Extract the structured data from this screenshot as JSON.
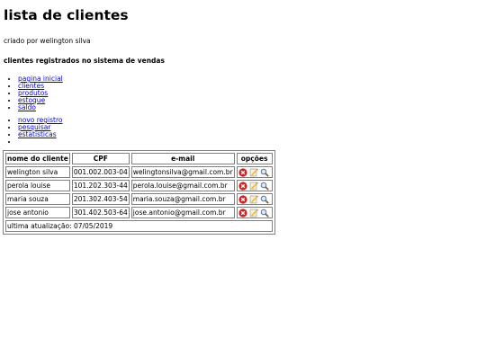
{
  "page": {
    "title": "lista de clientes",
    "subtitle": "criado por welington silva",
    "section_heading": "clientes registrados no sistema de vendas"
  },
  "nav": {
    "items": [
      {
        "label": "pagina inicial"
      },
      {
        "label": "clientes"
      },
      {
        "label": "produtos"
      },
      {
        "label": "estoque"
      },
      {
        "label": "saldo"
      }
    ]
  },
  "actions": {
    "items": [
      {
        "label": "novo registro"
      },
      {
        "label": "pesquisar"
      },
      {
        "label": "estatisticas"
      },
      {
        "label": ""
      }
    ]
  },
  "table": {
    "headers": [
      "nome do cliente",
      "CPF",
      "e-mail",
      "opções"
    ],
    "rows": [
      {
        "nome": "welington silva",
        "cpf": "001.002.003-04",
        "email": "welingtonsilva@gmail.com.br"
      },
      {
        "nome": "perola louise",
        "cpf": "101.202.303-44",
        "email": "perola.louise@gmail.com.br"
      },
      {
        "nome": "maria souza",
        "cpf": "201.302.403-54",
        "email": "maria.souza@gmail.com.br"
      },
      {
        "nome": "jose antonio",
        "cpf": "301.402.503-64",
        "email": "jose.antonio@gmail.com.br"
      }
    ],
    "row_icons": [
      "delete-icon",
      "edit-icon",
      "view-icon"
    ],
    "footer": "ultima atualização: 07/05/2019"
  },
  "colors": {
    "link": "#0000ee",
    "border": "#808080",
    "delete": "#cc2222",
    "edit": "#e8c040"
  }
}
